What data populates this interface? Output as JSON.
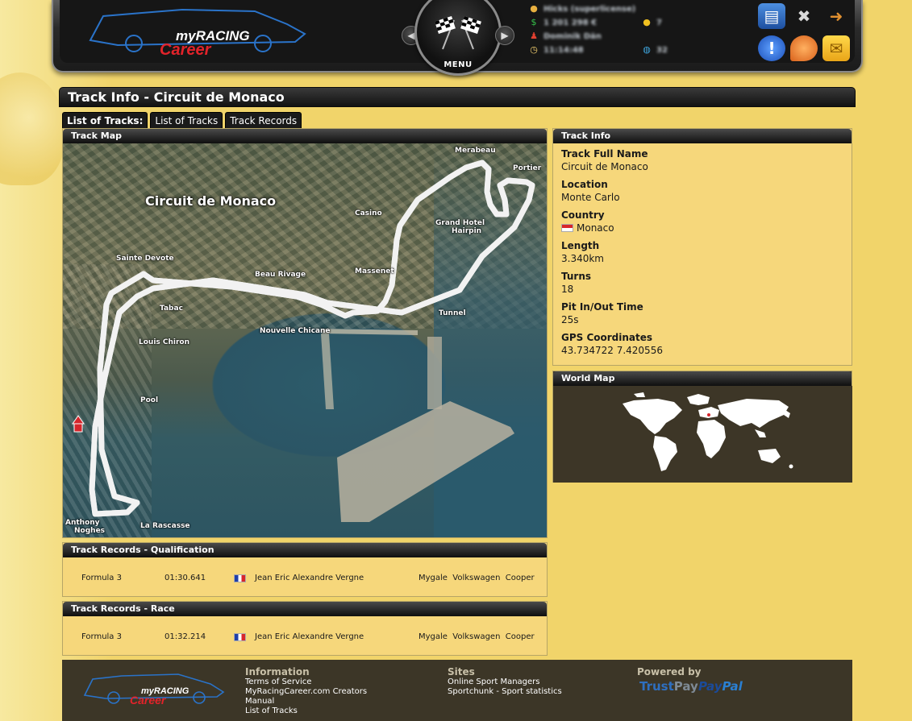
{
  "header": {
    "logo_text_top": "myRACING",
    "logo_text_bottom": "Career",
    "menu_label": "MENU",
    "stats": {
      "user": "Hicks (superlicense)",
      "money": "1 201 298 €",
      "coins": "7",
      "manager": "Dominik Dän",
      "time": "11:14:48",
      "online": "32"
    },
    "icons": [
      "book-icon",
      "tools-icon",
      "exit-door-icon",
      "alert-icon",
      "chat-bubble-icon",
      "mail-icon"
    ]
  },
  "page": {
    "title": "Track Info - Circuit de Monaco"
  },
  "tabs": {
    "label": "List of Tracks:",
    "list_of_tracks": "List of Tracks",
    "track_records": "Track Records"
  },
  "track_map": {
    "header": "Track Map",
    "title": "Circuit de Monaco",
    "labels": {
      "mirabeau": "Merabeau",
      "portier": "Portier",
      "casino": "Casino",
      "grand_hotel": "Grand Hotel",
      "hairpin": "Hairpin",
      "sainte_devote": "Sainte Devote",
      "beau_rivage": "Beau Rivage",
      "massenet": "Massenet",
      "tunnel": "Tunnel",
      "tabac": "Tabac",
      "nouvelle_chicane": "Nouvelle Chicane",
      "louis_chiron": "Louis Chiron",
      "pool": "Pool",
      "anthony": "Anthony",
      "noghes": "Noghes",
      "la_rascasse": "La Rascasse"
    }
  },
  "track_info": {
    "header": "Track Info",
    "items": [
      {
        "label": "Track Full Name",
        "value": "Circuit de Monaco"
      },
      {
        "label": "Location",
        "value": "Monte Carlo"
      },
      {
        "label": "Country",
        "value": "Monaco"
      },
      {
        "label": "Length",
        "value": "3.340km"
      },
      {
        "label": "Turns",
        "value": "18"
      },
      {
        "label": "Pit In/Out Time",
        "value": "25s"
      },
      {
        "label": "GPS Coordinates",
        "value": "43.734722 7.420556"
      }
    ]
  },
  "world_map": {
    "header": "World Map"
  },
  "records_qualification": {
    "header": "Track Records - Qualification",
    "series": "Formula 3",
    "time": "01:30.641",
    "driver": "Jean Eric Alexandre Vergne",
    "car": "Mygale  Volkswagen  Cooper"
  },
  "records_race": {
    "header": "Track Records - Race",
    "series": "Formula 3",
    "time": "01:32.214",
    "driver": "Jean Eric Alexandre Vergne",
    "car": "Mygale  Volkswagen  Cooper"
  },
  "footer": {
    "information": {
      "heading": "Information",
      "links": [
        "Terms of Service",
        "MyRacingCareer.com Creators",
        "Manual",
        "List of Tracks"
      ]
    },
    "sites": {
      "heading": "Sites",
      "links": [
        "Online Sport Managers",
        "Sportchunk - Sport statistics"
      ]
    },
    "powered": {
      "heading": "Powered by",
      "trust_a": "Trust",
      "trust_b": "Pay",
      "paypal_a": "Pay",
      "paypal_b": "Pal"
    }
  }
}
